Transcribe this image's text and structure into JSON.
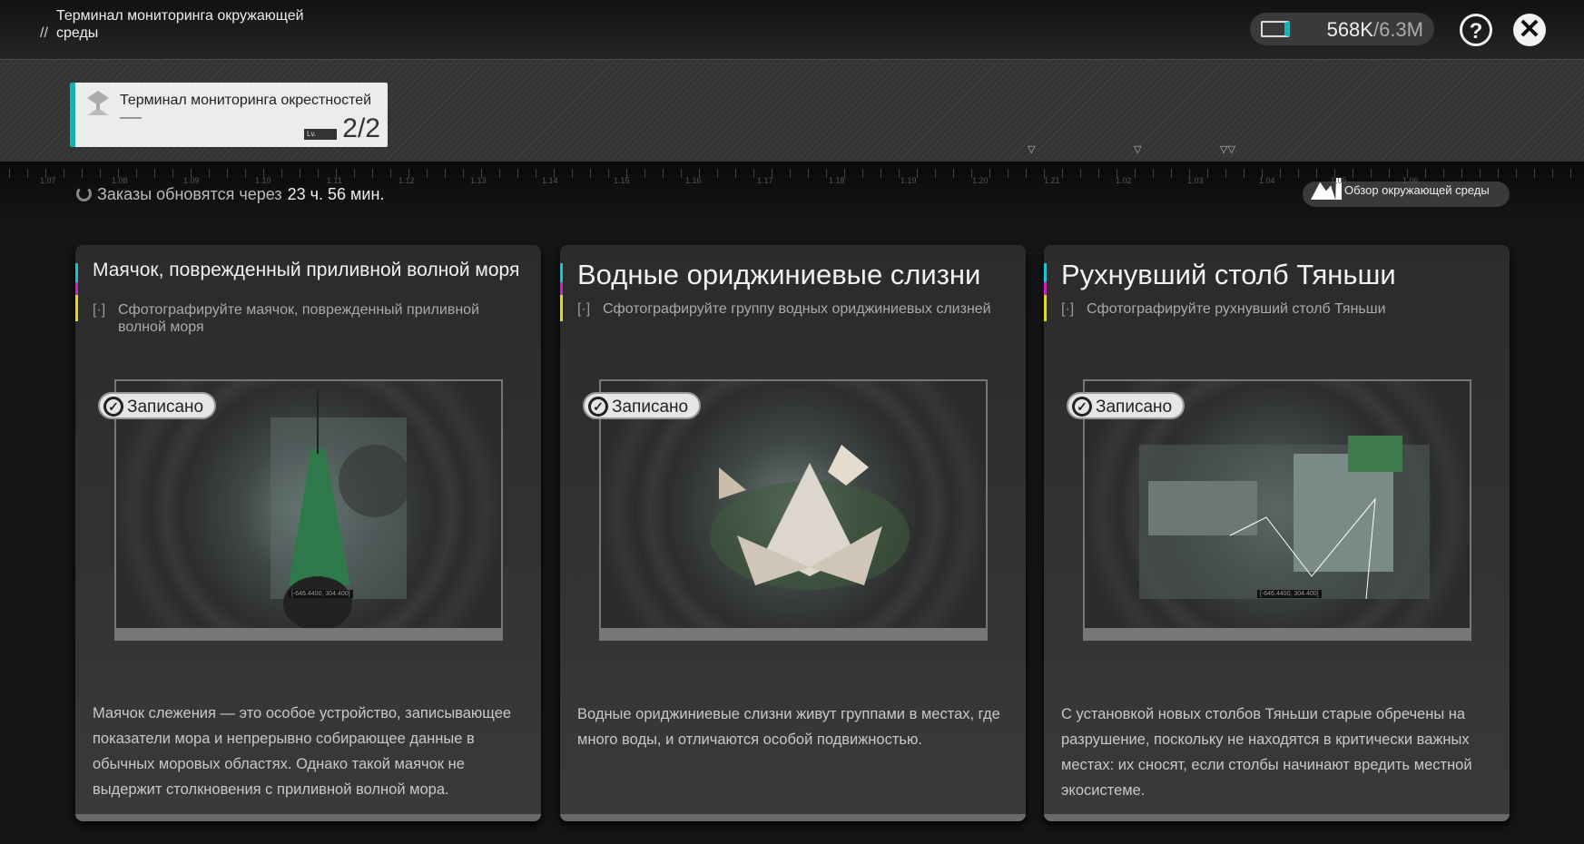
{
  "header": {
    "title_line1": "Терминал мониторинга окружающей",
    "title_line2": "среды",
    "title_prefix": "//",
    "resource_current": "568K",
    "resource_max": "/6.3M",
    "help_label": "?",
    "close_label": "✕"
  },
  "terminal": {
    "name": "Терминал мониторинга окрестностей",
    "level_label": "Lv.",
    "count": "2/2"
  },
  "timeline": {
    "labels": [
      "1.07",
      "1.08",
      "1.09",
      "1.10",
      "1.11",
      "1.12",
      "1.13",
      "1.14",
      "1.15",
      "1.16",
      "1.17",
      "1.18",
      "1.19",
      "1.20",
      "1.21",
      "1.02",
      "1.03",
      "1.04",
      "1.05",
      "1.06"
    ]
  },
  "refresh": {
    "label": "Заказы обновятся через",
    "time": "23 ч. 56 мин."
  },
  "overview_button": "Обзор окружающей среды",
  "accent": "#13b3b0",
  "cards": [
    {
      "title": "Маячок, поврежденный приливной волной моря",
      "subtitle": "Сфотографируйте маячок, поврежденный приливной волной моря",
      "bracket": "[·]",
      "status": "Записано",
      "coords": "[-646.4400, 304.400]",
      "description": "Маячок слежения — это особое устройство, записывающее показатели мора и непрерывно собирающее данные в обычных моровых областях. Однако такой маячок не выдержит столкновения с приливной волной мора."
    },
    {
      "title": "Водные ориджиниевые слизни",
      "subtitle": "Сфотографируйте группу водных ориджиниевых слизней",
      "bracket": "[·]",
      "status": "Записано",
      "description": "Водные ориджиниевые слизни живут группами в местах, где много воды, и отличаются особой подвижностью."
    },
    {
      "title": "Рухнувший столб Тяньши",
      "subtitle": "Сфотографируйте рухнувший столб Тяньши",
      "bracket": "[·]",
      "status": "Записано",
      "coords": "[-646.4400, 304.400]",
      "description": "С установкой новых столбов Тяньши старые обречены на разрушение, поскольку не находятся в критически важных местах: их сносят, если столбы начинают вредить местной экосистеме."
    }
  ]
}
